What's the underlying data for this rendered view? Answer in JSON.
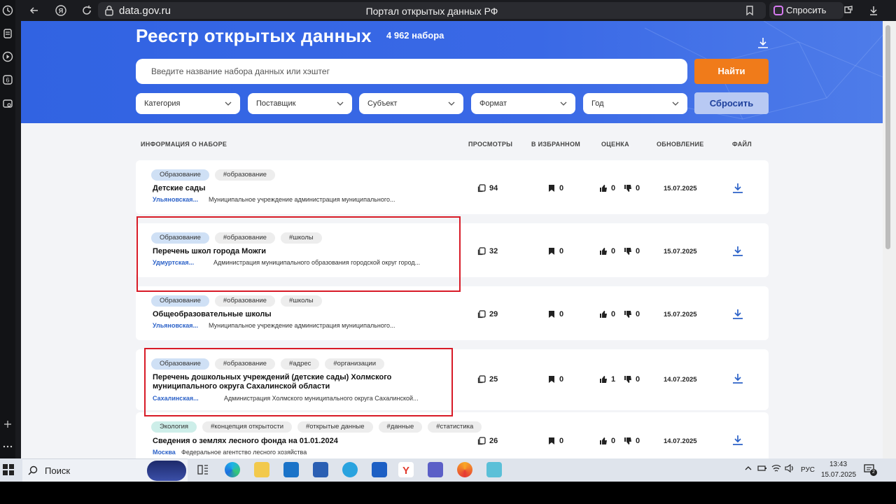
{
  "browser": {
    "url": "data.gov.ru",
    "page_title": "Портал открытых данных РФ",
    "ask_label": "Спросить"
  },
  "hero": {
    "title": "Реестр открытых данных",
    "count": "4 962 набора",
    "search_placeholder": "Введите название набора данных или хэштег",
    "find_label": "Найти",
    "reset_label": "Сбросить",
    "filters": [
      "Категория",
      "Поставщик",
      "Субъект",
      "Формат",
      "Год"
    ]
  },
  "table": {
    "headers": {
      "info": "ИНФОРМАЦИЯ О НАБОРЕ",
      "views": "ПРОСМОТРЫ",
      "favorites": "В ИЗБРАННОМ",
      "rating": "ОЦЕНКА",
      "updated": "ОБНОВЛЕНИЕ",
      "file": "ФАЙЛ"
    },
    "rows": [
      {
        "category": "Образование",
        "tags": [
          "#образование"
        ],
        "title": "Детские сады",
        "region": "Ульяновская...",
        "org": "Муниципальное учреждение администрация муниципального...",
        "views": "94",
        "favorites": "0",
        "likes": "0",
        "dislikes": "0",
        "date": "15.07.2025"
      },
      {
        "category": "Образование",
        "tags": [
          "#образование",
          "#школы"
        ],
        "title": "Перечень школ города Можги",
        "region": "Удмуртская...",
        "org": "Администрация муниципального образования городской округ город...",
        "views": "32",
        "favorites": "0",
        "likes": "0",
        "dislikes": "0",
        "date": "15.07.2025"
      },
      {
        "category": "Образование",
        "tags": [
          "#образование",
          "#школы"
        ],
        "title": "Общеобразовательные школы",
        "region": "Ульяновская...",
        "org": "Муниципальное учреждение администрация муниципального...",
        "views": "29",
        "favorites": "0",
        "likes": "0",
        "dislikes": "0",
        "date": "15.07.2025"
      },
      {
        "category": "Образование",
        "tags": [
          "#образование",
          "#адрес",
          "#организации"
        ],
        "title": "Перечень дошкольных учреждений (детские сады) Холмского муниципального округа Сахалинской области",
        "region": "Сахалинская...",
        "org": "Администрация Холмского муниципального округа Сахалинской...",
        "views": "25",
        "favorites": "0",
        "likes": "1",
        "dislikes": "0",
        "date": "14.07.2025"
      },
      {
        "category": "Экология",
        "tags": [
          "#концепция открытости",
          "#открытые данные",
          "#данные",
          "#статистика"
        ],
        "title": "Сведения о землях лесного фонда на 01.01.2024",
        "region": "Москва",
        "org": "Федеральное агентство лесного хозяйства",
        "views": "26",
        "favorites": "0",
        "likes": "0",
        "dislikes": "0",
        "date": "14.07.2025"
      }
    ]
  },
  "taskbar": {
    "search_label": "Поиск",
    "lang": "РУС",
    "time": "13:43",
    "date": "15.07.2025",
    "notifications": "2"
  },
  "colors": {
    "hero_blue": "#3163e2",
    "find_orange": "#f07b1a",
    "link_blue": "#2c62c8",
    "highlight_red": "#d81b27"
  }
}
